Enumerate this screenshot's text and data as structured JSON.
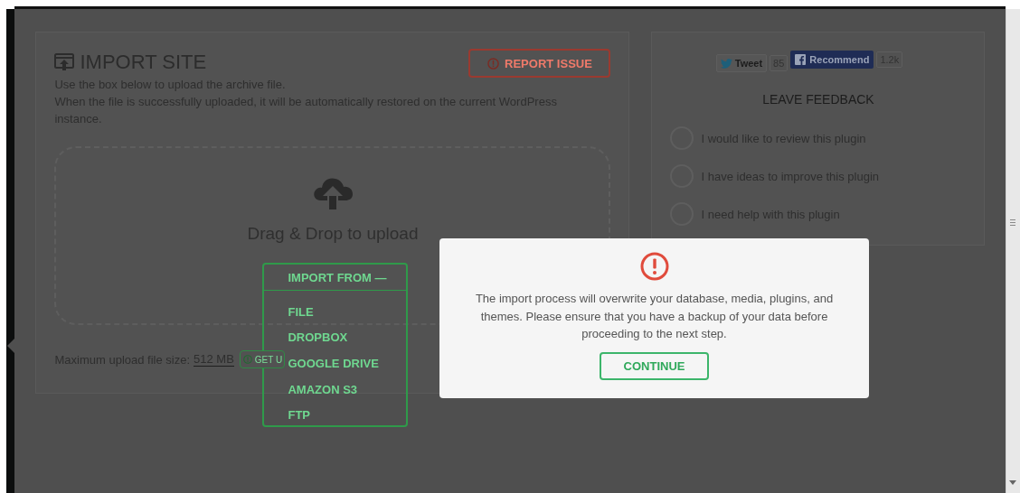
{
  "import_panel": {
    "title": "IMPORT SITE",
    "report_button": "REPORT ISSUE",
    "description": [
      "Use the box below to upload the archive file.",
      "When the file is successfully uploaded, it will be automatically restored on the current WordPress instance."
    ],
    "dropzone": {
      "label": "Drag & Drop to upload"
    },
    "import_menu": {
      "label": "IMPORT FROM",
      "toggle": "—",
      "expanded": true,
      "items": [
        "FILE",
        "DROPBOX",
        "GOOGLE DRIVE",
        "AMAZON S3",
        "FTP"
      ]
    },
    "max_size": {
      "label": "Maximum upload file size:",
      "value": "512 MB",
      "button": "GET U"
    }
  },
  "feedback_panel": {
    "tweet": {
      "label": "Tweet",
      "count": "85"
    },
    "recommend": {
      "label": "Recommend",
      "count": "1.2k"
    },
    "title": "LEAVE FEEDBACK",
    "options": [
      {
        "label": "I would like to review this plugin",
        "selected": false
      },
      {
        "label": "I have ideas to improve this plugin",
        "selected": false
      },
      {
        "label": "I need help with this plugin",
        "selected": false
      }
    ]
  },
  "dialog": {
    "message": "The import process will overwrite your database, media, plugins, and themes. Please ensure that you have a backup of your data before proceeding to the next step.",
    "button": "CONTINUE"
  }
}
